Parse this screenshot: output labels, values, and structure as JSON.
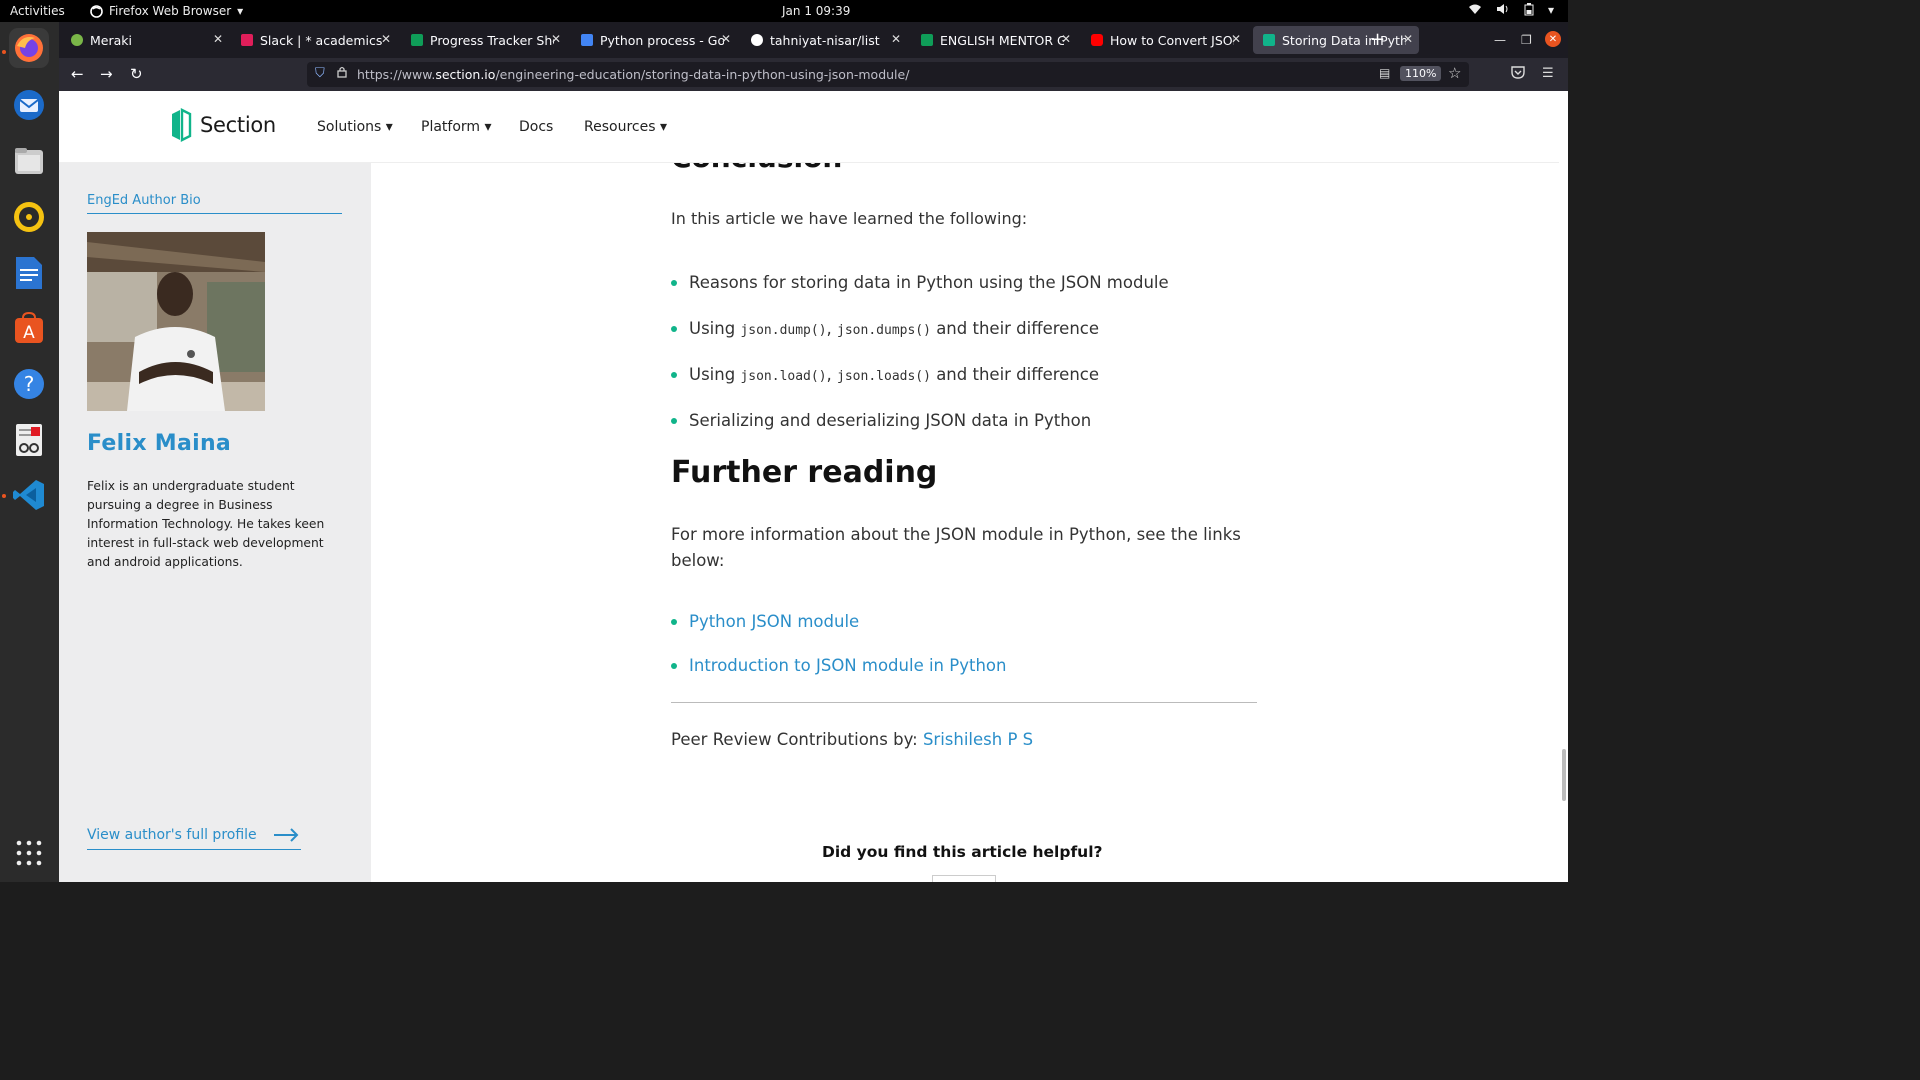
{
  "system": {
    "activities": "Activities",
    "app_menu": "Firefox Web Browser",
    "clock": "Jan 1  09:39"
  },
  "dock": [
    "firefox-icon",
    "thunderbird-icon",
    "files-icon",
    "rhythmbox-icon",
    "libreoffice-writer-icon",
    "software-center-icon",
    "help-icon",
    "document-viewer-icon",
    "vscode-icon",
    "app-grid-icon"
  ],
  "browser": {
    "tabs": [
      {
        "label": "Meraki",
        "favicon_color": "#7ab648"
      },
      {
        "label": "Slack | * academics | N",
        "favicon_color": "#e01e5a"
      },
      {
        "label": "Progress Tracker Shee",
        "favicon_color": "#0f9d58"
      },
      {
        "label": "Python process - Goog",
        "favicon_color": "#4285f4"
      },
      {
        "label": "tahniyat-nisar/list",
        "favicon_color": "#ffffff"
      },
      {
        "label": "ENGLISH MENTOR GRO",
        "favicon_color": "#0f9d58"
      },
      {
        "label": "How to Convert JSON",
        "favicon_color": "#ff0000"
      },
      {
        "label": "Storing Data in Python",
        "favicon_color": "#10b48a"
      }
    ],
    "url_prefix": "https://www.",
    "url_domain": "section.io",
    "url_path": "/engineering-education/storing-data-in-python-using-json-module/",
    "zoom": "110%"
  },
  "site": {
    "logo": "Section",
    "menu": [
      "Solutions ▾",
      "Platform ▾",
      "Docs",
      "Resources ▾"
    ]
  },
  "author": {
    "label": "EngEd Author Bio",
    "name": "Felix Maina",
    "bio": "Felix is an undergraduate student pursuing a degree in Business Information Technology. He takes keen interest in full-stack web development and android applications.",
    "profile_link": "View author's full profile"
  },
  "article": {
    "conclusion_heading": "Conclusion",
    "intro": "In this article we have learned the following:",
    "learned": {
      "b1": "Reasons for storing data in Python using the JSON module",
      "b2_pre": "Using ",
      "b2_code1": "json.dump()",
      "b2_sep": ", ",
      "b2_code2": "json.dumps()",
      "b2_post": " and their difference",
      "b3_pre": "Using ",
      "b3_code1": "json.load()",
      "b3_sep": ", ",
      "b3_code2": "json.loads()",
      "b3_post": " and their difference",
      "b4": "Serializing and deserializing JSON data in Python"
    },
    "further_heading": "Further reading",
    "more_info": "For more information about the JSON module in Python, see the links below:",
    "links": [
      "Python JSON module",
      "Introduction to JSON module in Python"
    ],
    "peer_label": "Peer Review Contributions by: ",
    "peer_name": "Srishilesh P S",
    "helpful": "Did you find this article helpful?"
  }
}
